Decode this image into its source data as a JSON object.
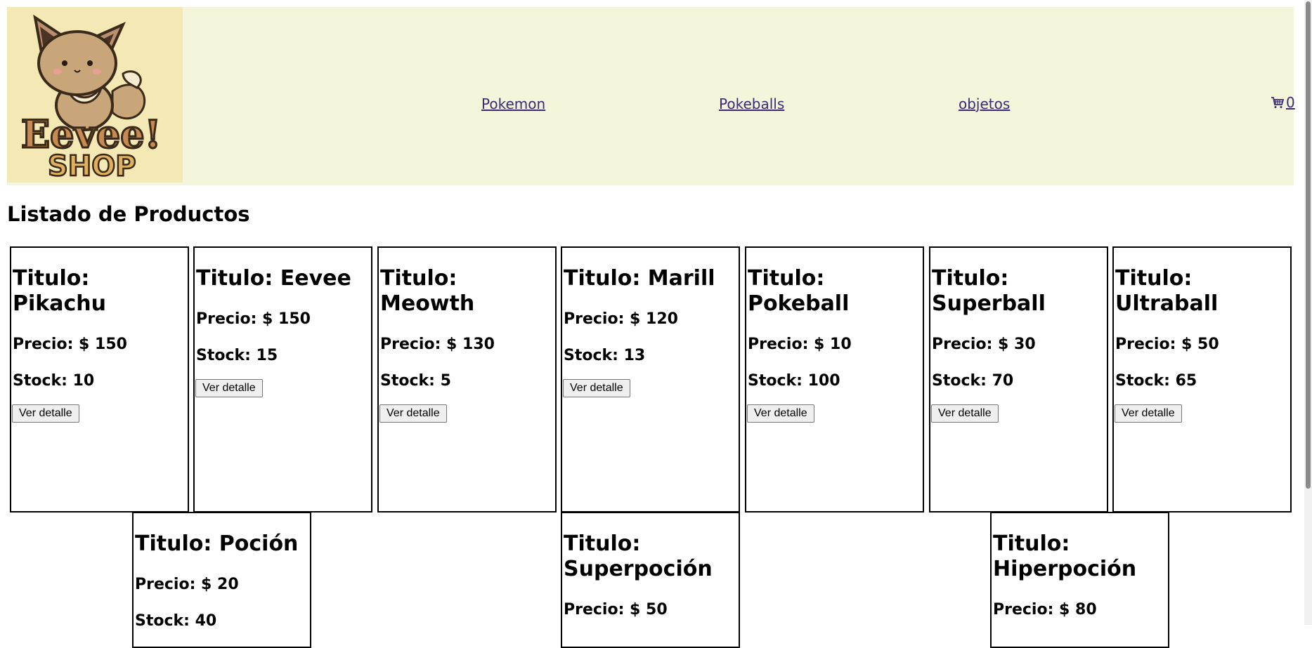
{
  "header": {
    "logo_text_1": "Eevee!",
    "logo_text_2": "SHOP",
    "nav": [
      {
        "label": "Pokemon"
      },
      {
        "label": "Pokeballs"
      },
      {
        "label": "objetos"
      }
    ],
    "cart": {
      "icon": "cart-icon",
      "count": "0"
    }
  },
  "main": {
    "heading": "Listado de Productos",
    "button_label": "Ver detalle",
    "products": [
      {
        "title": "Titulo: Pikachu",
        "price": "Precio: $ 150",
        "stock": "Stock: 10"
      },
      {
        "title": "Titulo: Eevee",
        "price": "Precio: $ 150",
        "stock": "Stock: 15"
      },
      {
        "title": "Titulo: Meowth",
        "price": "Precio: $ 130",
        "stock": "Stock: 5"
      },
      {
        "title": "Titulo: Marill",
        "price": "Precio: $ 120",
        "stock": "Stock: 13"
      },
      {
        "title": "Titulo: Pokeball",
        "price": "Precio: $ 10",
        "stock": "Stock: 100"
      },
      {
        "title": "Titulo: Superball",
        "price": "Precio: $ 30",
        "stock": "Stock: 70"
      },
      {
        "title": "Titulo: Ultraball",
        "price": "Precio: $ 50",
        "stock": "Stock: 65"
      },
      {
        "title": "Titulo: Poción",
        "price": "Precio: $ 20",
        "stock": "Stock: 40"
      },
      {
        "title": "Titulo: Superpoción",
        "price": "Precio: $ 50",
        "stock": ""
      },
      {
        "title": "Titulo: Hiperpoción",
        "price": "Precio: $ 80",
        "stock": ""
      }
    ]
  },
  "colors": {
    "header_bg": "#f5f5dc",
    "logo_bg": "#f4e8b4",
    "link": "#3b2a7a"
  }
}
